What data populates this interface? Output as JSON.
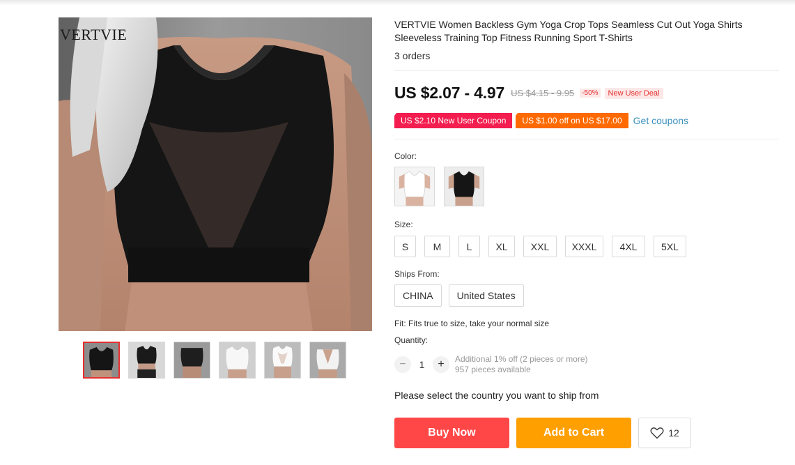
{
  "gallery": {
    "watermark": "VERTVIE",
    "thumbnails": [
      "black crop top front",
      "black crop top with shorts",
      "black crop top side",
      "white crop top front",
      "white crop top detail",
      "white crop top back"
    ],
    "active_index": 0
  },
  "product": {
    "title": "VERTVIE Women Backless Gym Yoga Crop Tops Seamless Cut Out Yoga Shirts Sleeveless Training Top Fitness Running Sport T-Shirts",
    "orders": "3 orders",
    "price": "US $2.07 - 4.97",
    "original_price": "US $4.15 - 9.95",
    "discount": "-50%",
    "deal_badge": "New User Deal"
  },
  "coupons": {
    "new_user": "US $2.10 New User Coupon",
    "store": "US $1.00 off on US $17.00",
    "get_label": "Get coupons"
  },
  "options": {
    "color_label": "Color:",
    "colors": [
      "white",
      "black"
    ],
    "size_label": "Size:",
    "sizes": [
      "S",
      "M",
      "L",
      "XL",
      "XXL",
      "XXXL",
      "4XL",
      "5XL"
    ],
    "ships_label": "Ships From:",
    "ships_from": [
      "CHINA",
      "United States"
    ]
  },
  "fit_note": "Fit: Fits true to size, take your normal size",
  "quantity": {
    "label": "Quantity:",
    "minus": "−",
    "value": "1",
    "plus": "+",
    "discount_note": "Additional 1% off (2 pieces or more)",
    "available": "957 pieces available"
  },
  "ship_country_note": "Please select the country you want to ship from",
  "actions": {
    "buy_now": "Buy Now",
    "add_to_cart": "Add to Cart",
    "wishlist_count": "12"
  },
  "colors": {
    "price_red": "#e62e2e",
    "coupon_red": "#f31d4f",
    "coupon_orange": "#ff6a00",
    "buy_now": "#ff4747",
    "add_to_cart": "#ff9f00",
    "link_blue": "#3a8fbc"
  }
}
